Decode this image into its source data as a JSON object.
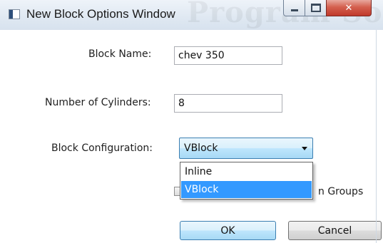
{
  "window": {
    "title": "New Block Options Window",
    "watermark": "Program Sol"
  },
  "form": {
    "block_name_label": "Block Name:",
    "block_name_value": "chev 350",
    "cylinders_label": "Number of Cylinders:",
    "cylinders_value": "8",
    "config_label": "Block Configuration:",
    "config_selected": "VBlock",
    "config_options": [
      "Inline",
      "VBlock"
    ],
    "checkbox_label_visible": "n Groups",
    "checkbox_checked": false
  },
  "buttons": {
    "ok_label": "OK",
    "cancel_label": "Cancel"
  },
  "colors": {
    "selection": "#3399ff",
    "focus_border": "#3c7fb1",
    "close_button": "#c0392b"
  },
  "icons": {
    "app": "window-app-icon",
    "minimize": "minimize-icon",
    "maximize": "maximize-icon",
    "close": "close-icon",
    "dropdown": "chevron-down-icon"
  }
}
